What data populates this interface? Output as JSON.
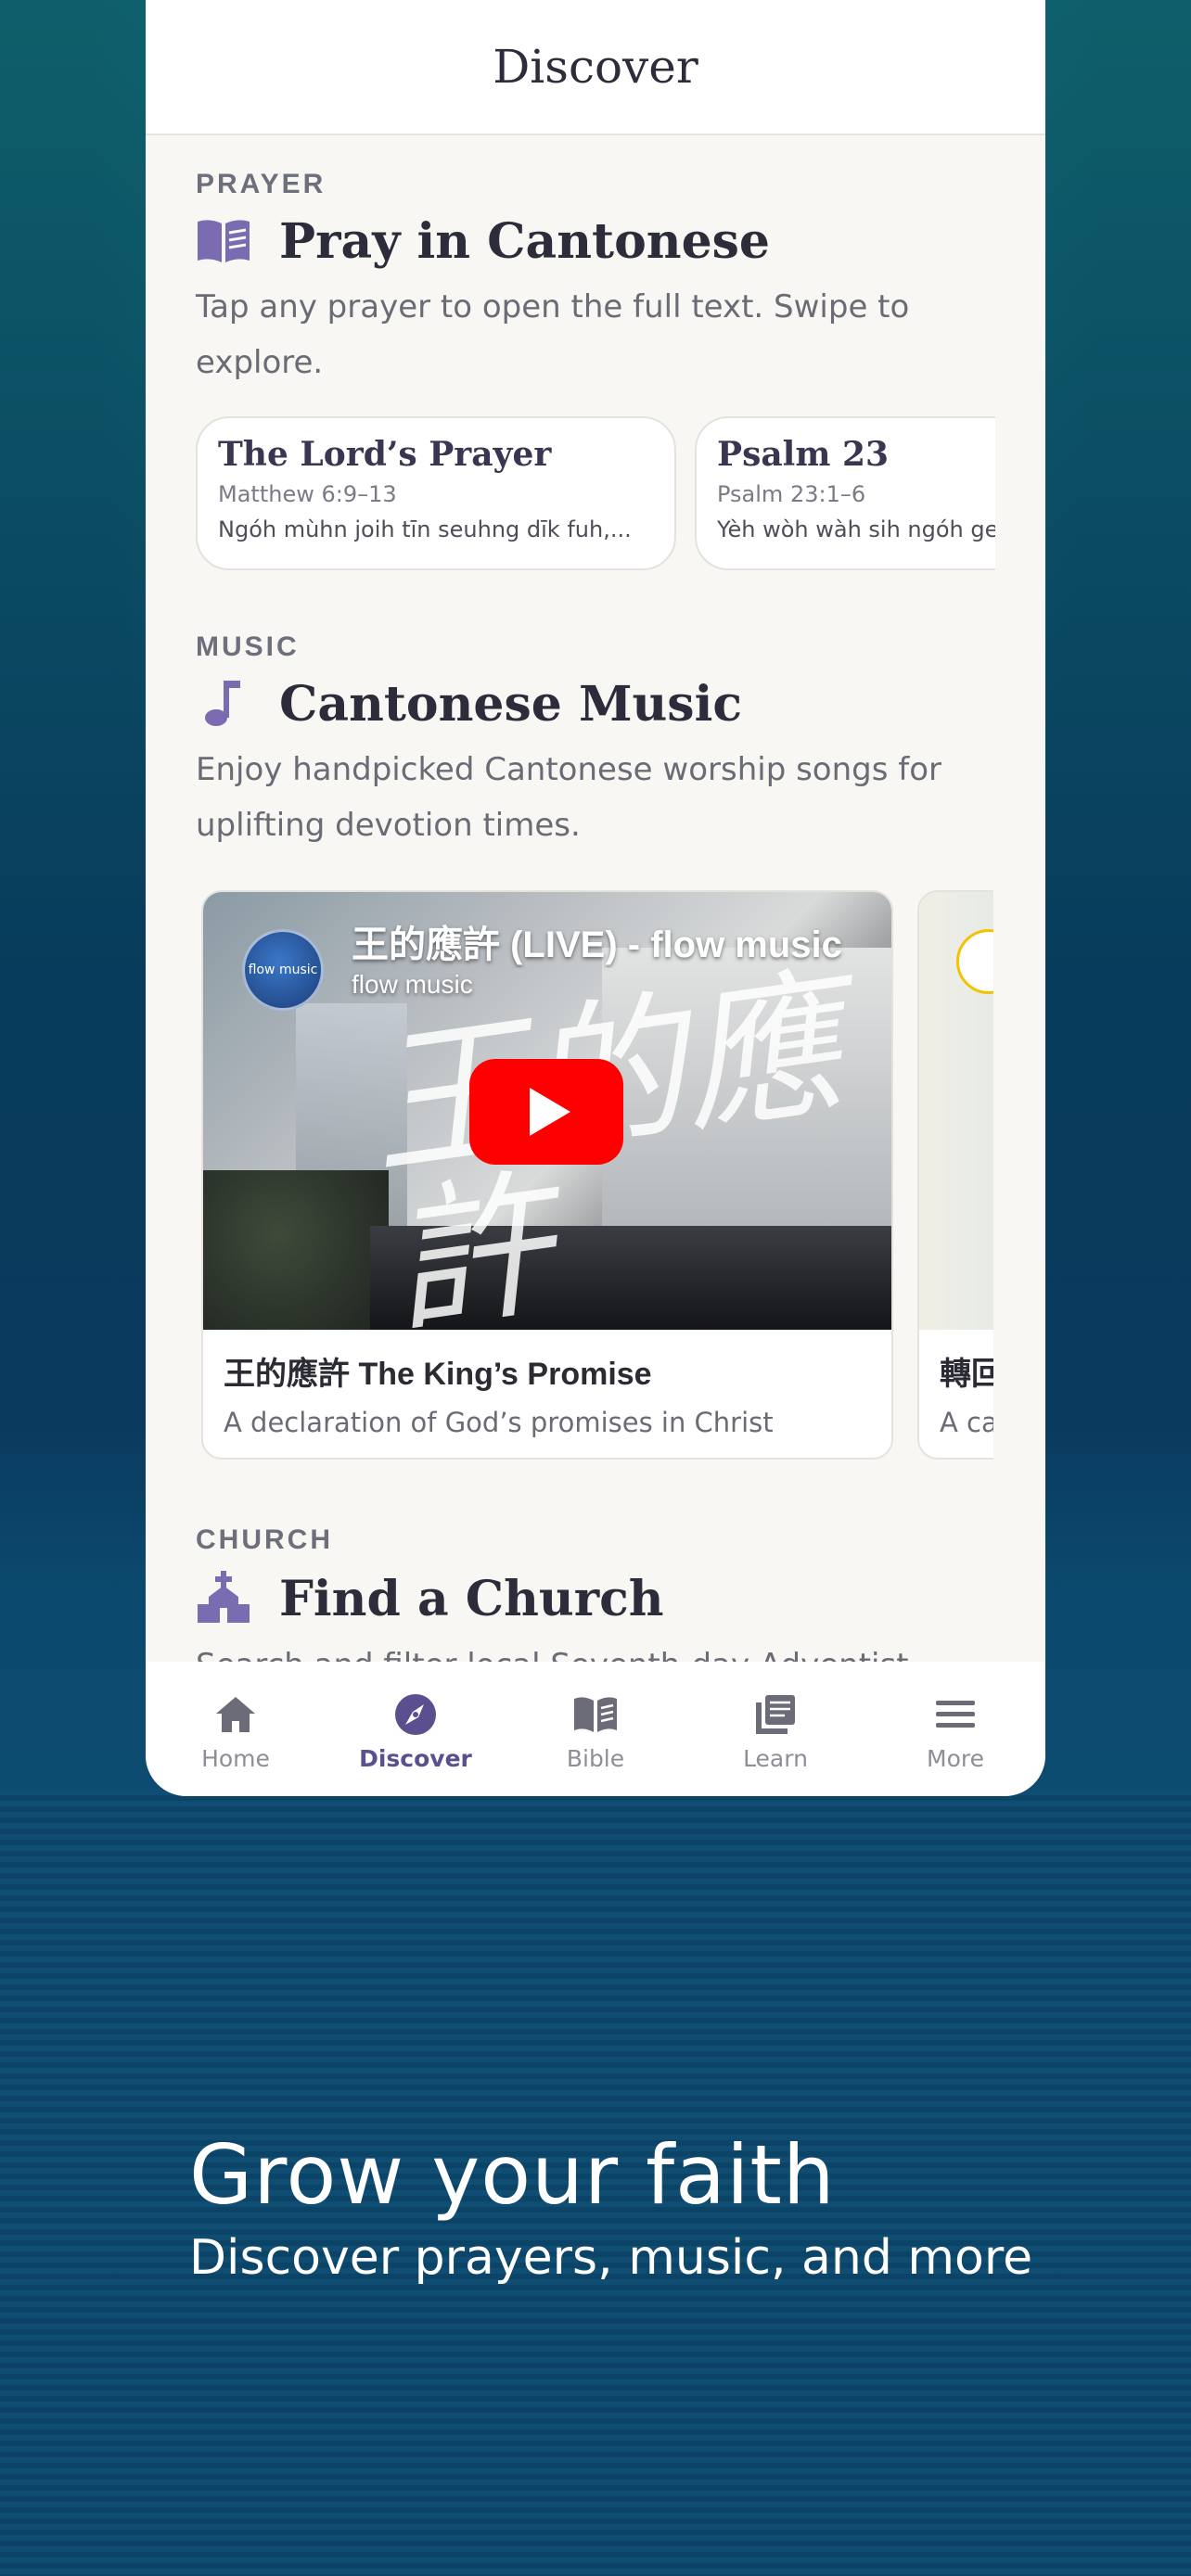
{
  "header": {
    "title": "Discover"
  },
  "prayer_section": {
    "kicker": "PRAYER",
    "title": "Pray in Cantonese",
    "icon": "book-open-icon",
    "description": "Tap any prayer to open the full text. Swipe to explore.",
    "cards": [
      {
        "title": "The Lord’s Prayer",
        "ref": "Matthew 6:9–13",
        "text": "Ngóh mùhn joih tīn seuhng dīk fuh,..."
      },
      {
        "title": "Psalm 23",
        "ref": "Psalm 23:1–6",
        "text": "Yèh wòh wàh sih ngóh ge m"
      }
    ]
  },
  "music_section": {
    "kicker": "MUSIC",
    "title": "Cantonese Music",
    "icon": "music-note-icon",
    "description": "Enjoy handpicked Cantonese worship songs for uplifting devotion times.",
    "videos": [
      {
        "yt_title": "王的應許 (LIVE) - flow music",
        "channel": "flow music",
        "channel_logo_text": "flow music",
        "overlay_text": "王的應許",
        "title": "王的應許 The King’s Promise",
        "subtitle": "A declaration of God’s promises in Christ"
      },
      {
        "title": "轉回",
        "subtitle": "A cal"
      }
    ]
  },
  "church_section": {
    "kicker": "CHURCH",
    "title": "Find a Church",
    "icon": "church-icon",
    "description": "Search and filter local Seventh-day Adventist"
  },
  "nav": {
    "items": [
      {
        "label": "Home",
        "icon": "home-icon",
        "active": false
      },
      {
        "label": "Discover",
        "icon": "compass-icon",
        "active": true
      },
      {
        "label": "Bible",
        "icon": "bible-icon",
        "active": false
      },
      {
        "label": "Learn",
        "icon": "learn-icon",
        "active": false
      },
      {
        "label": "More",
        "icon": "menu-icon",
        "active": false
      }
    ]
  },
  "promo": {
    "headline": "Grow your faith",
    "subheadline": "Discover prayers, music, and more"
  },
  "colors": {
    "accent": "#7b6bb0",
    "active_nav": "#5b4f8f",
    "youtube_red": "#ff0000"
  }
}
